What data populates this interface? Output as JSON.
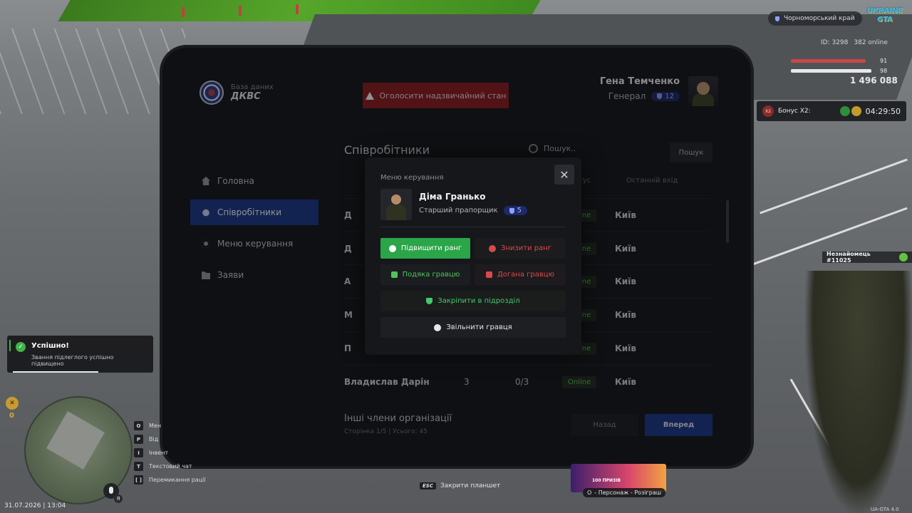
{
  "tablet": {
    "brand_sub": "База даних",
    "brand_name": "ДКВС",
    "alarm_label": "Оголосити надзвичайний стан",
    "user": {
      "name": "Гена Темченко",
      "rank": "Генерал",
      "rank_level": "12"
    }
  },
  "sidebar": {
    "items": [
      {
        "label": "Головна",
        "icon": "home-icon"
      },
      {
        "label": "Співробітники",
        "icon": "people-icon",
        "active": true
      },
      {
        "label": "Меню керування",
        "icon": "gear-icon"
      },
      {
        "label": "Заяви",
        "icon": "folder-icon"
      }
    ]
  },
  "main": {
    "title": "Співробітники",
    "search_placeholder": "Пошук..",
    "search_button": "Пошук",
    "columns": {
      "status": "Статус",
      "last_login": "Останній вхід"
    },
    "rows": [
      {
        "name": "Д",
        "status": "Online",
        "city": "Київ"
      },
      {
        "name": "Д",
        "status": "Online",
        "city": "Київ"
      },
      {
        "name": "А",
        "status": "Online",
        "city": "Київ"
      },
      {
        "name": "М",
        "status": "Online",
        "city": "Київ"
      },
      {
        "name": "П",
        "status": "Online",
        "city": "Київ"
      },
      {
        "name": "Владислав Дарін",
        "rank": "3",
        "warns": "0/3",
        "status": "Online",
        "city": "Київ"
      }
    ],
    "others_title": "Інші члени організації",
    "pager_text": "Сторінка 1/5 | Усього: 45",
    "back_label": "Назад",
    "forward_label": "Вперед"
  },
  "modal": {
    "title": "Меню керування",
    "player_name": "Діма Гранько",
    "player_rank": "Старший прапорщик",
    "player_rank_level": "5",
    "buttons": {
      "promote": "Підвищити ранг",
      "demote": "Знизити ранг",
      "thanks": "Подяка гравцю",
      "reprimand": "Догана гравцю",
      "assign": "Закріпити в підрозділ",
      "fire": "Звільнити гравця"
    }
  },
  "hud": {
    "region": "Чорноморський край",
    "logo": "UKRAINE GTA",
    "id": "ID: 3298",
    "online": "382 online",
    "health": 91,
    "armor": 98,
    "money": "1 496 088",
    "bonus_label": "Бонус X2:",
    "bonus_badge": "X2",
    "bonus_timer": "04:29:50",
    "stranger": "Незнайомець #11025",
    "toast_title": "Успішно!",
    "toast_text": "Звання підлеглого успішно підвищено",
    "compass_value": "0",
    "keys": [
      {
        "key": "O",
        "label": "Мен"
      },
      {
        "key": "P",
        "label": "Від"
      },
      {
        "key": "I",
        "label": "Інвент"
      },
      {
        "key": "T",
        "label": "Текстовий чат"
      },
      {
        "key": "[ ]",
        "label": "Перемикання рації"
      }
    ],
    "lang": "Я",
    "datetime": "31.07.2026 | 13:04",
    "esc_key": "ESC",
    "esc_label": "Закрити планшет",
    "promo_caption": "- Персонаж - Розіграш",
    "promo_key": "O",
    "promo_text": "100 ПРИЗІВ",
    "version": "UA-GTA 4.0"
  }
}
